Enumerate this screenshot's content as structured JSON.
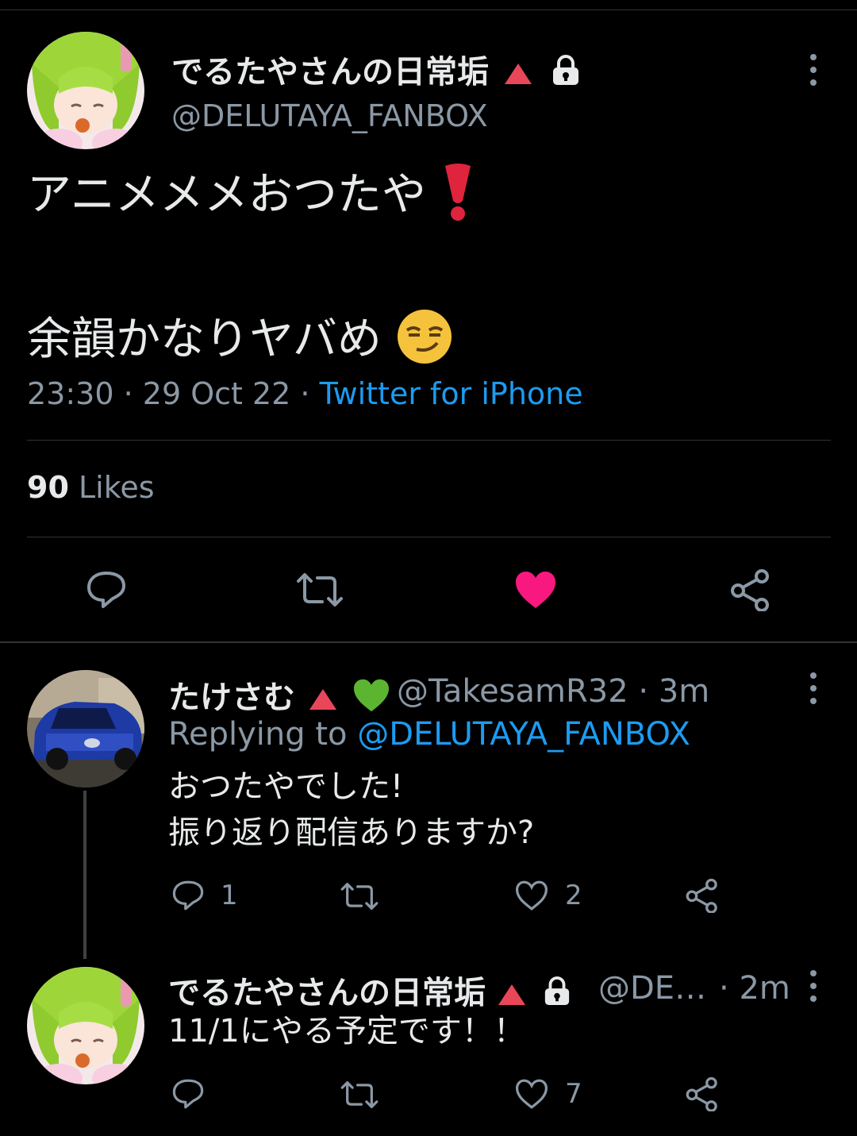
{
  "tweet": {
    "display_name": "でるたやさんの日常垢",
    "handle": "@DELUTAYA_FANBOX",
    "line1": "アニメメメおつたや",
    "line1_emoji": "❗",
    "line2": "余韻かなりヤバめ",
    "line2_emoji": "😏",
    "time": "23:30",
    "date": "29 Oct 22",
    "source": "Twitter for iPhone",
    "likes_count": "90",
    "likes_label": "Likes",
    "liked": true
  },
  "replies": [
    {
      "display_name": "たけさむ",
      "heart": "💚",
      "handle": "@TakesamR32",
      "age": "3m",
      "replying_prefix": "Replying to",
      "replying_to": "@DELUTAYA_FANBOX",
      "line1": "おつたやでした!",
      "line2": "振り返り配信ありますか?",
      "reply_count": "1",
      "like_count": "2"
    },
    {
      "display_name": "でるたやさんの日常垢",
      "handle": "@DE…",
      "age": "2m",
      "line1": "11/1にやる予定です！！",
      "like_count": "7"
    }
  ],
  "colors": {
    "background": "#000000",
    "accent_blue": "#1d9bf0",
    "like_pink": "#f91880",
    "badge_red": "#e8475a",
    "muted": "#8b98a5"
  },
  "icons": [
    "reply-icon",
    "retweet-icon",
    "like-icon",
    "share-icon",
    "lock-icon",
    "more-icon"
  ]
}
